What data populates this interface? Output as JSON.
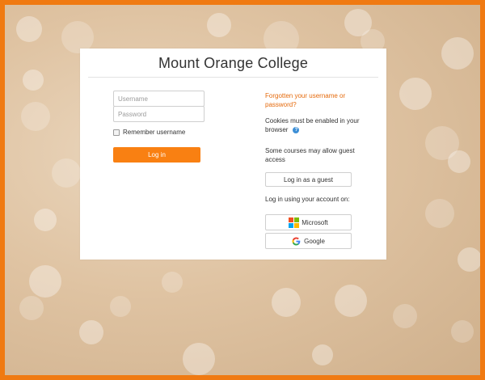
{
  "site": {
    "title": "Mount Orange College"
  },
  "login_form": {
    "username_placeholder": "Username",
    "password_placeholder": "Password",
    "remember_label": "Remember username",
    "login_button": "Log in"
  },
  "help": {
    "forgot_link": "Forgotten your username or password?",
    "cookies_text": "Cookies must be enabled in your browser",
    "guest_text": "Some courses may allow guest access",
    "guest_button": "Log in as a guest",
    "oauth_label": "Log in using your account on:",
    "providers": [
      {
        "label": "Microsoft",
        "icon": "microsoft-icon"
      },
      {
        "label": "Google",
        "icon": "google-icon"
      }
    ]
  },
  "colors": {
    "accent": "#f98012",
    "border": "#f07a12",
    "link": "#e56a0c",
    "help_icon": "#3d8fd6"
  }
}
